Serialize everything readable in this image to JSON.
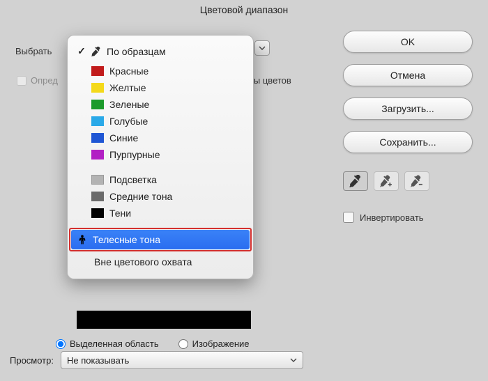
{
  "title": "Цветовой диапазон",
  "selectLabel": "Выбрать",
  "detectFacesLabel": "Опред",
  "localizedLabel": "боры цветов",
  "dropdown": {
    "sampled": "По образцам",
    "colors": [
      {
        "label": "Красные",
        "hex": "#c11b1b"
      },
      {
        "label": "Желтые",
        "hex": "#f4d91a"
      },
      {
        "label": "Зеленые",
        "hex": "#1a9a2a"
      },
      {
        "label": "Голубые",
        "hex": "#2aa9e8"
      },
      {
        "label": "Синие",
        "hex": "#1f56d4"
      },
      {
        "label": "Пурпурные",
        "hex": "#b21fc4"
      }
    ],
    "tones": [
      {
        "label": "Подсветка",
        "cls": "sw-gray"
      },
      {
        "label": "Средние тона",
        "cls": "sw-dark"
      },
      {
        "label": "Тени",
        "cls": "sw-black"
      }
    ],
    "skinTones": "Телесные тона",
    "outOfGamut": "Вне цветового охвата"
  },
  "buttons": {
    "ok": "OK",
    "cancel": "Отмена",
    "load": "Загрузить...",
    "save": "Сохранить..."
  },
  "invertLabel": "Инвертировать",
  "radios": {
    "selection": "Выделенная область",
    "image": "Изображение"
  },
  "previewLabel": "Просмотр:",
  "previewValue": "Не показывать"
}
